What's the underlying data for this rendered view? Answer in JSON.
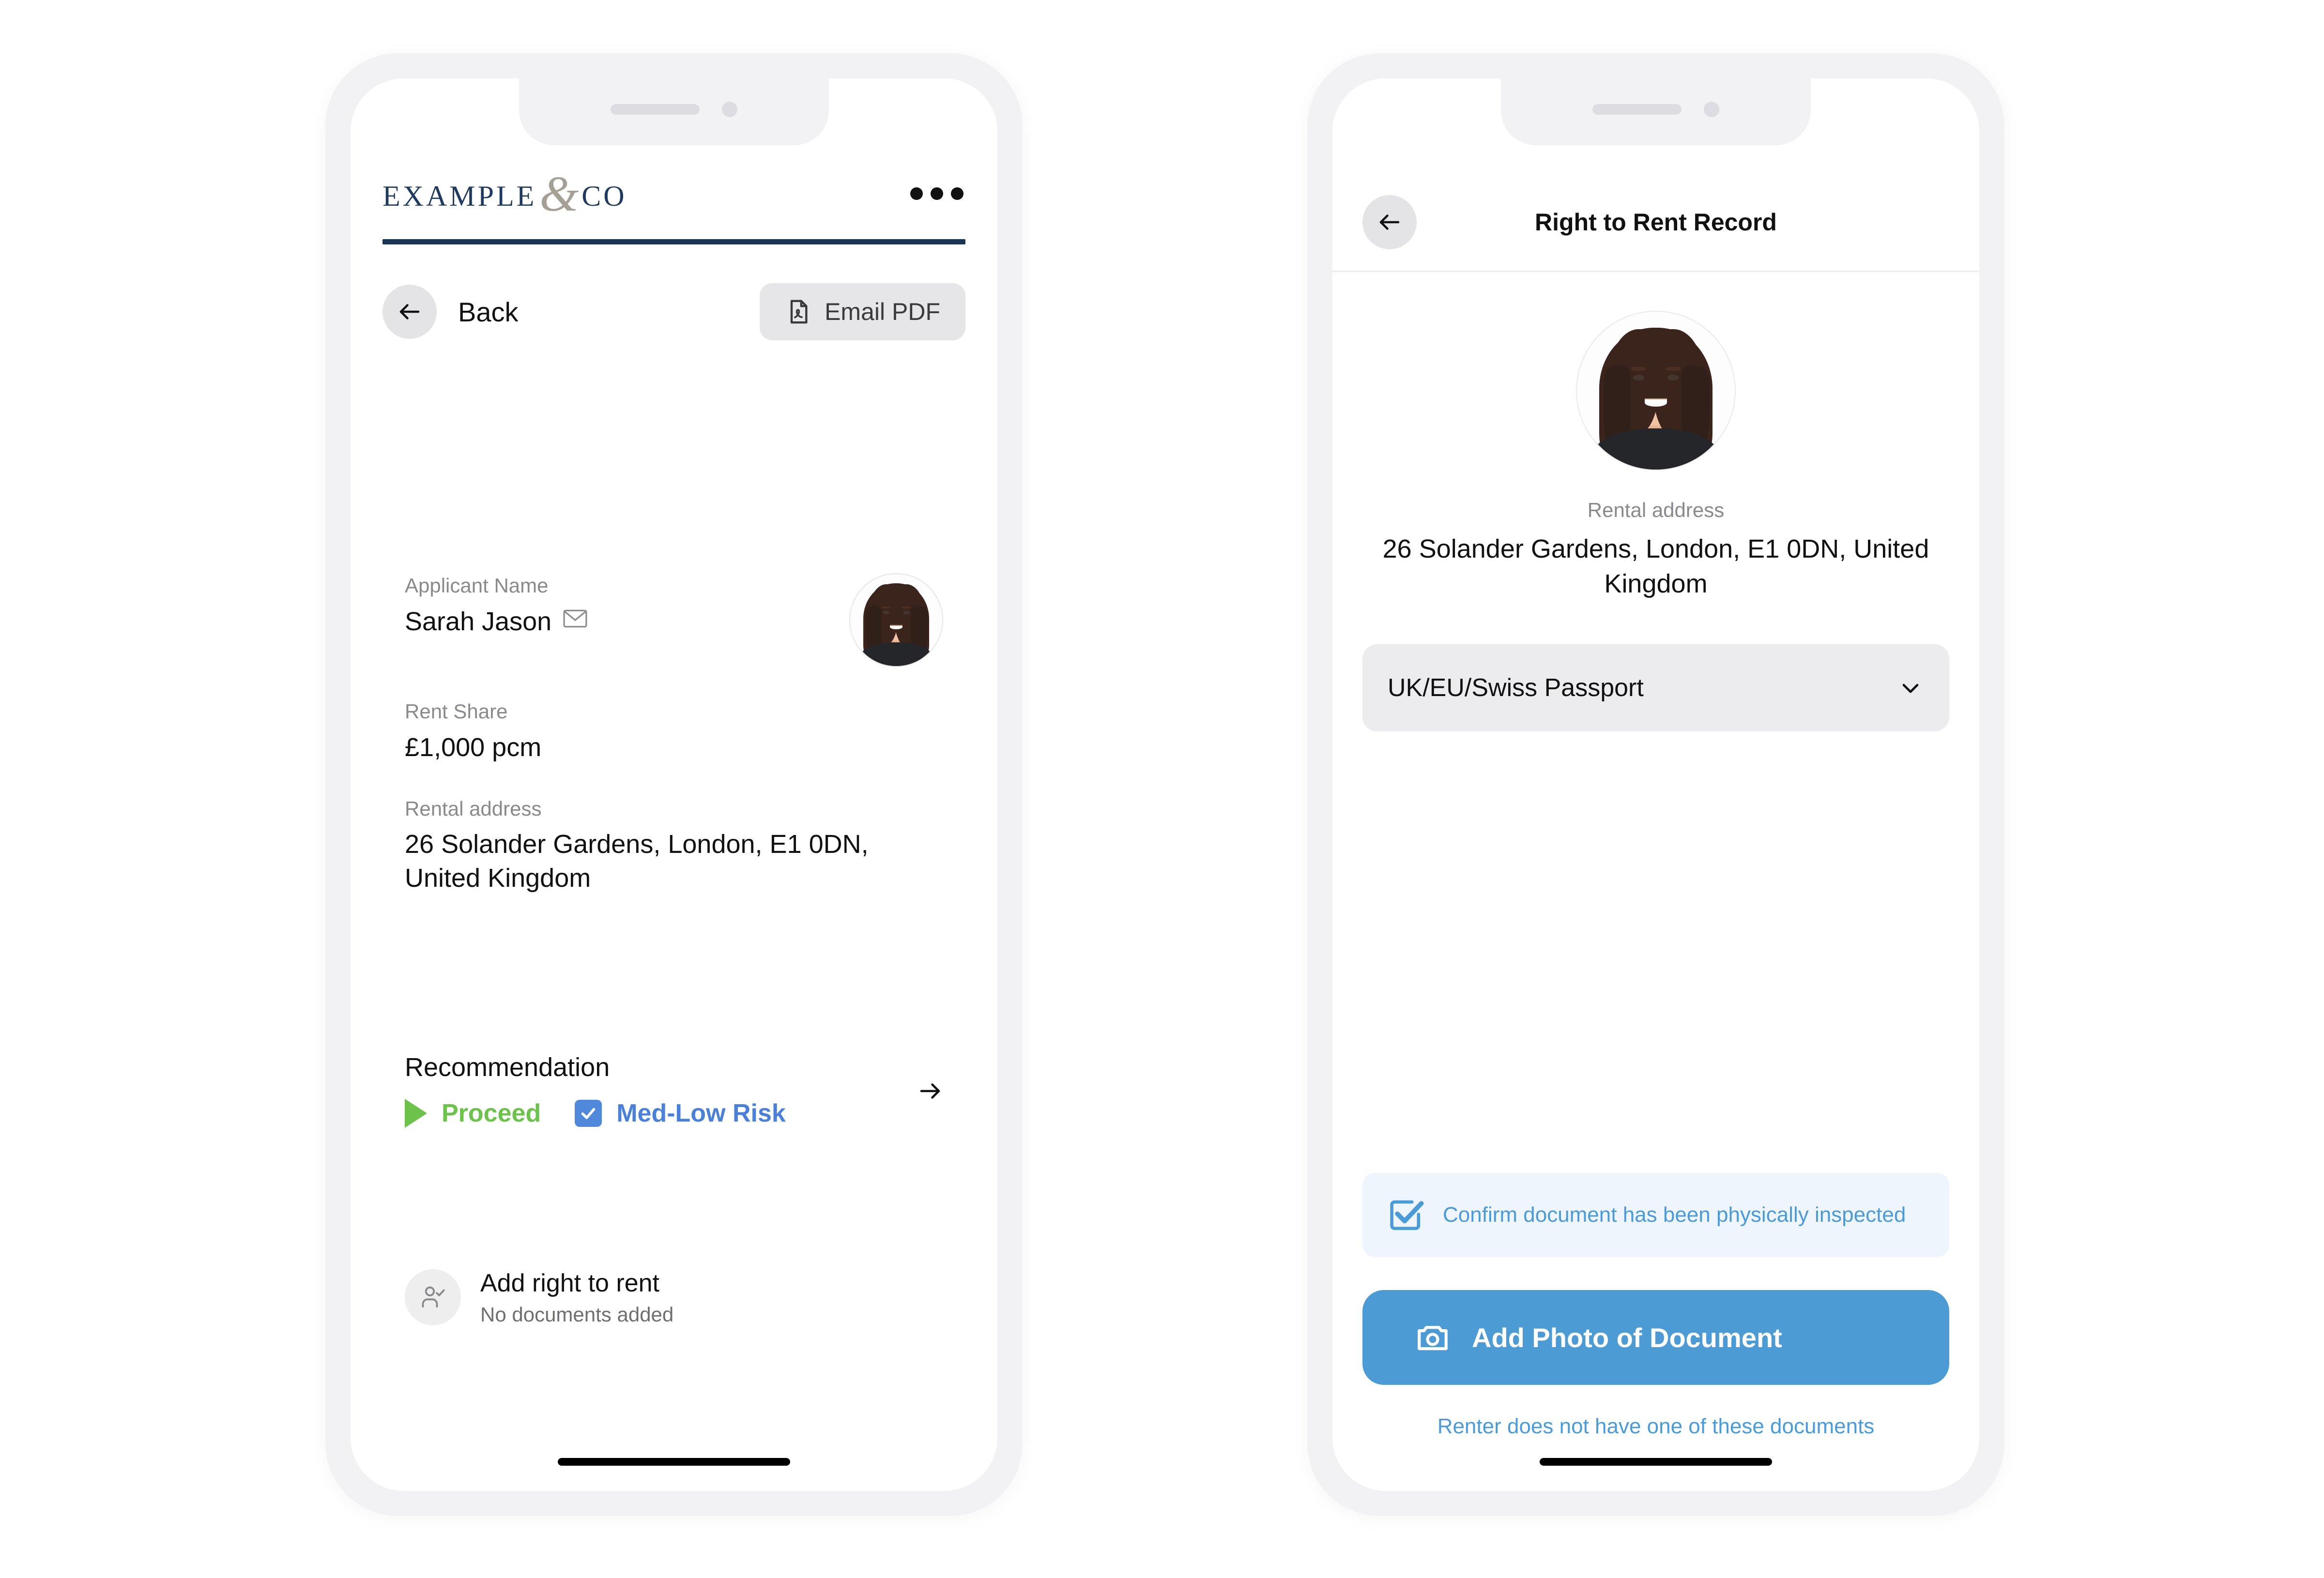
{
  "brand": {
    "name_part1": "EXAMPLE",
    "ampersand": "&",
    "name_part2": "CO",
    "navy": "#1f3a5f",
    "amp_color": "#a5a096"
  },
  "left_phone": {
    "menu_icon": "kebab-menu-icon",
    "nav": {
      "back_icon": "arrow-left-icon",
      "back_label": "Back",
      "email_pdf_icon": "pdf-file-icon",
      "email_pdf_label": "Email PDF"
    },
    "applicant_card": {
      "name_label": "Applicant Name",
      "name_value": "Sarah Jason",
      "mail_icon": "envelope-icon",
      "avatar": "applicant-avatar",
      "rent_label": "Rent Share",
      "rent_value": "£1,000 pcm",
      "address_label": "Rental address",
      "address_value": "26 Solander Gardens, London, E1 0DN, United Kingdom"
    },
    "recommendation_card": {
      "title": "Recommendation",
      "status_icon": "play-triangle-icon",
      "status_label": "Proceed",
      "status_color": "#6cc24a",
      "risk_icon": "checkbox-checked-icon",
      "risk_label": "Med-Low Risk",
      "risk_color": "#4a80d8",
      "chevron_icon": "arrow-right-icon"
    },
    "add_rtr_card": {
      "icon": "person-check-icon",
      "title": "Add right to rent",
      "subtitle": "No documents added"
    }
  },
  "right_phone": {
    "header": {
      "back_icon": "arrow-left-icon",
      "title": "Right to Rent Record"
    },
    "avatar": "renter-avatar",
    "address_label": "Rental address",
    "address_value": "26 Solander Gardens, London, E1 0DN, United Kingdom",
    "document_select": {
      "value": "UK/EU/Swiss Passport",
      "chevron_icon": "chevron-down-icon"
    },
    "confirm": {
      "icon": "checkbox-check-outline-icon",
      "text": "Confirm document has been physically inspected",
      "color": "#4a9bd8"
    },
    "cta": {
      "icon": "camera-icon",
      "label": "Add Photo of Document",
      "bg_color": "#4d9bd5"
    },
    "alt_link": "Renter does not have one of these documents"
  }
}
